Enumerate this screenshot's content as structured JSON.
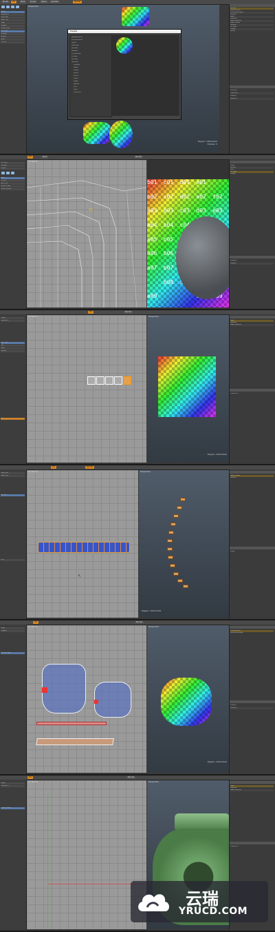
{
  "tabs": [
    "Model",
    "UV",
    "Paint",
    "Sculpt",
    "Setup",
    "Animate",
    "Render"
  ],
  "viewports": {
    "perspective": "Perspective",
    "uv": "UV Texture",
    "top": "Top"
  },
  "dialog": {
    "title": "Presets",
    "items": [
      "Backgrounds",
      "Environments",
      "Lights",
      "Materials",
      "Brushes",
      "Meshes",
      "Procedurals",
      "Profiles",
      "Shaders",
      "Textures",
      "Patterns",
      "Metal",
      "Plastic",
      "Stone",
      "Wood",
      "Fabric",
      "Glass",
      "Liquids",
      "Skin",
      "Paint",
      "Ceramics"
    ]
  },
  "left_tools": [
    "Select",
    "Transform",
    "Duplicate",
    "Mesh Edit",
    "Edge",
    "Polygon",
    "Vertex Map",
    "UV Tools",
    "Unwrap",
    "Project",
    "Relax",
    "Fit UVs",
    "Pack UVs",
    "Move & Sew",
    "Orient Pieces",
    "Flip",
    "Align",
    "Spread",
    "Pin",
    "Grid"
  ],
  "right_items": [
    "Render",
    "Environment",
    "Directional Light",
    "Camera",
    "Mesh",
    "Material",
    "Base Material",
    "Base Shader",
    "Texture",
    "UV Map",
    "Image",
    "Group",
    "Layer",
    "Locator",
    "Item",
    "Property",
    "Channel",
    "Transform",
    "Position",
    "Rotation",
    "Scale",
    "Display"
  ],
  "uv_labels": [
    "b01",
    "c01",
    "d01",
    "e01",
    "b02",
    "c02",
    "d02",
    "e02",
    "f02",
    "a03",
    "b03",
    "c03",
    "d03",
    "e03",
    "a04",
    "b04",
    "c04",
    "a05",
    "b05",
    "a06",
    "b06",
    "a07",
    "b07",
    "b08",
    "c08",
    "a09",
    "d09",
    "e09"
  ],
  "status": {
    "polygons": "Polygons : Catmull-Clark",
    "channels": "Channels : 0"
  },
  "watermark": {
    "cn": "云瑞",
    "en": "YRUCD.COM"
  },
  "colors": {
    "accent": "#e08a1e",
    "selection": "#5a7aa8"
  }
}
